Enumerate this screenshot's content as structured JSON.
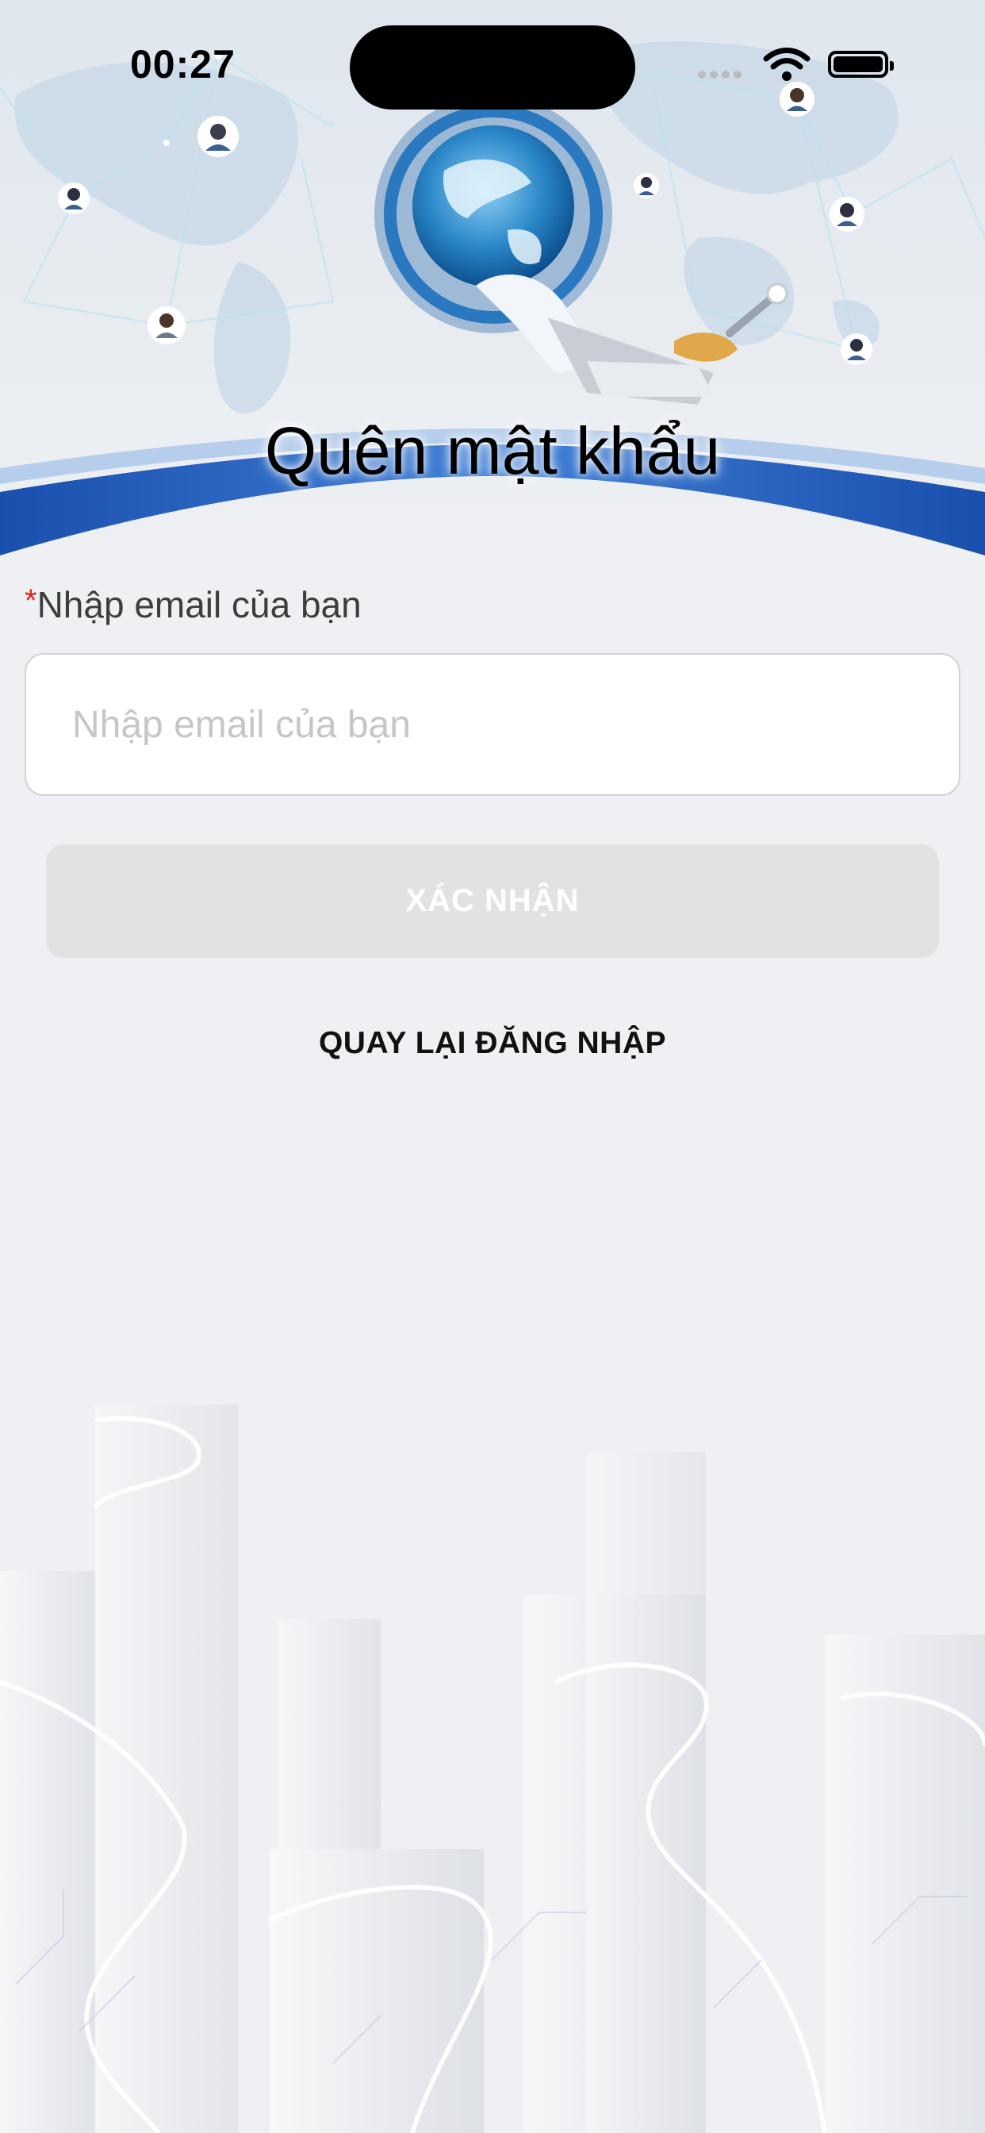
{
  "status_bar": {
    "time": "00:27",
    "icons": [
      "signal-dots-icon",
      "wifi-icon",
      "battery-icon"
    ]
  },
  "header": {
    "title": "Quên mật khẩu",
    "illustration": "globe-network-illustration"
  },
  "form": {
    "required_mark": "*",
    "email_label": "Nhập email của bạn",
    "email_placeholder": "Nhập email của bạn",
    "email_value": ""
  },
  "actions": {
    "confirm_label": "XÁC NHẬN",
    "back_to_login_label": "QUAY LẠI ĐĂNG NHẬP"
  },
  "colors": {
    "background": "#eef0f3",
    "band_blue": "#1f56b6",
    "required_red": "#e0221a",
    "button_disabled": "#e2e2e3"
  }
}
